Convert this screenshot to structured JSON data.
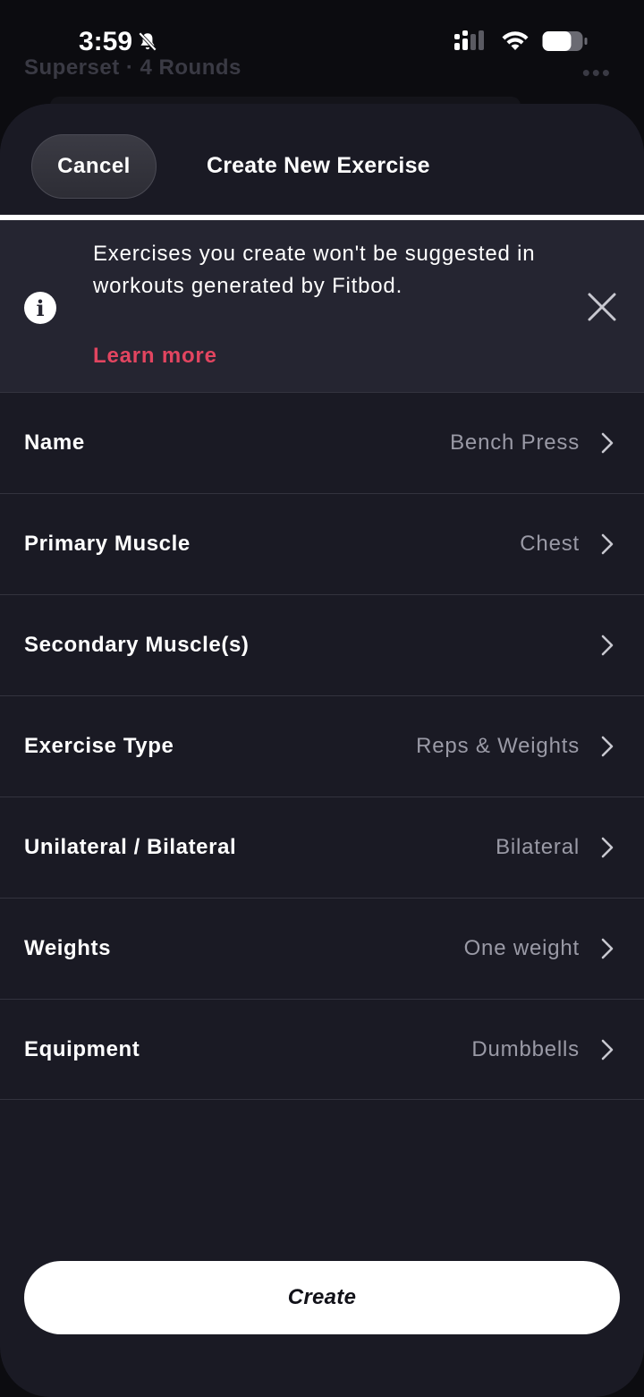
{
  "status_bar": {
    "time": "3:59"
  },
  "background": {
    "title": "Superset · 4 Rounds",
    "more": "•••"
  },
  "sheet": {
    "cancel_label": "Cancel",
    "title": "Create New Exercise"
  },
  "banner": {
    "text": "Exercises you create won't be suggested in workouts generated by Fitbod.",
    "learn_more": "Learn more",
    "info_glyph": "i"
  },
  "rows": [
    {
      "label": "Name",
      "value": "Bench Press"
    },
    {
      "label": "Primary Muscle",
      "value": "Chest"
    },
    {
      "label": "Secondary Muscle(s)",
      "value": ""
    },
    {
      "label": "Exercise Type",
      "value": "Reps & Weights"
    },
    {
      "label": "Unilateral / Bilateral",
      "value": "Bilateral"
    },
    {
      "label": "Weights",
      "value": "One weight"
    },
    {
      "label": "Equipment",
      "value": "Dumbbells"
    }
  ],
  "create_label": "Create",
  "colors": {
    "accent": "#e24560",
    "sheet_bg": "#1a1a24",
    "banner_bg": "#252531"
  },
  "icons": [
    "bell-slash-icon",
    "cellular-signal-icon",
    "wifi-icon",
    "battery-icon",
    "info-icon",
    "close-icon",
    "chevron-right-icon"
  ]
}
